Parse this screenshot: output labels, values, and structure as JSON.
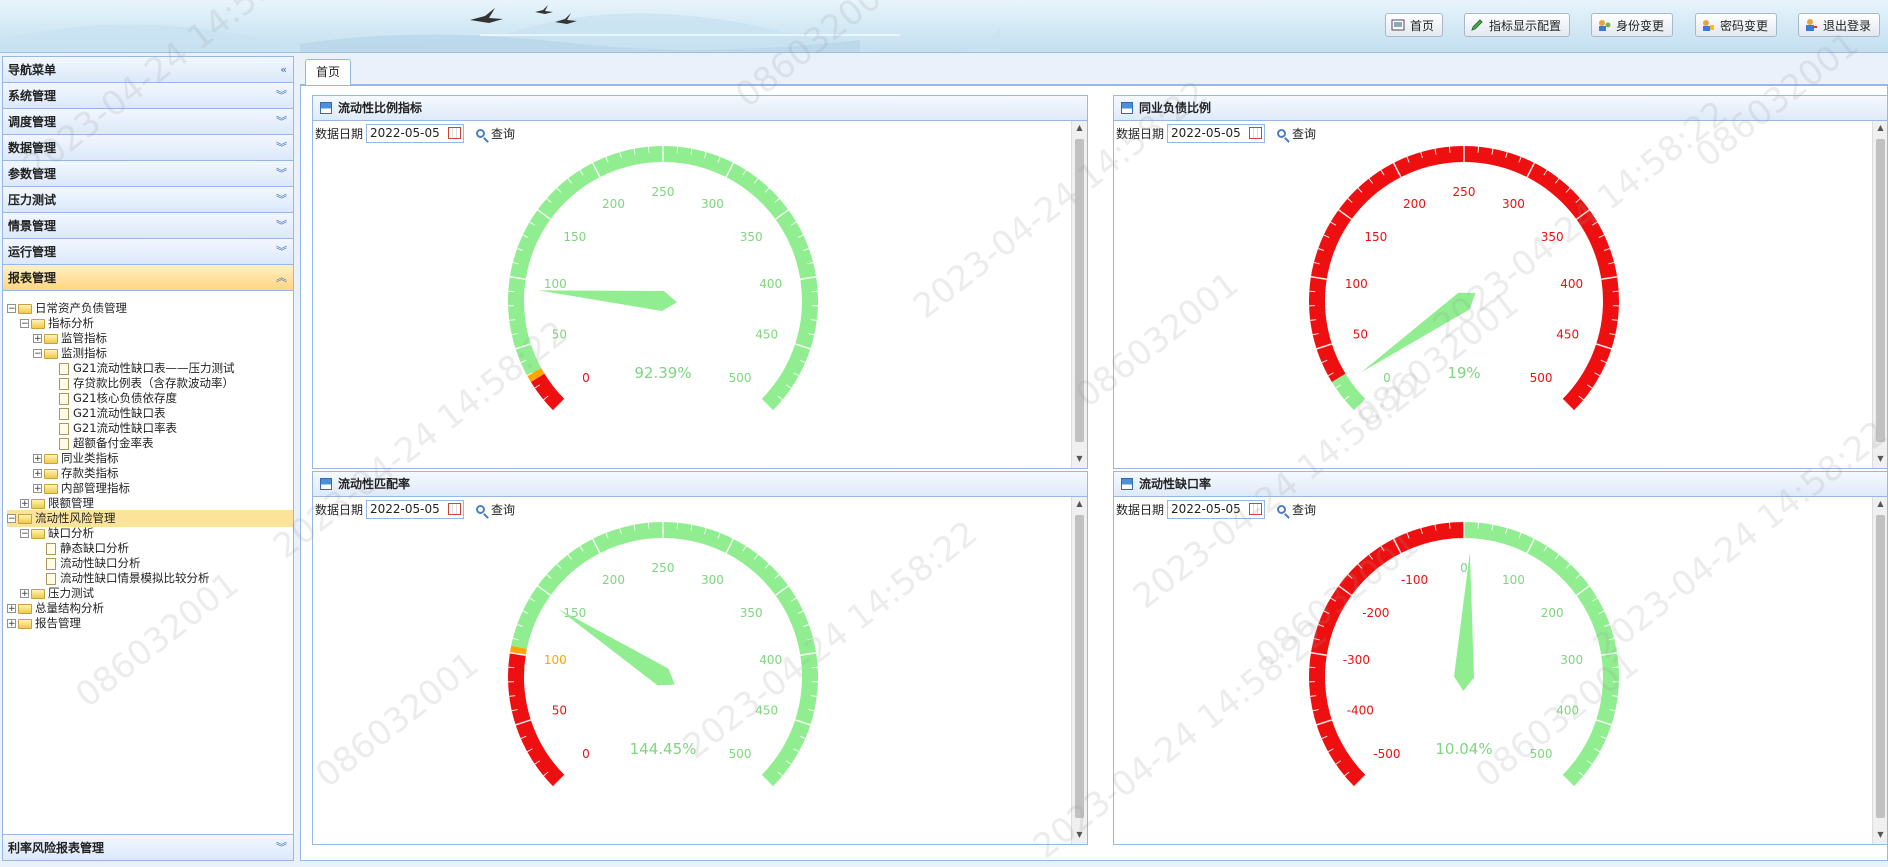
{
  "topbar": {
    "buttons": [
      {
        "label": "首页",
        "icon": "home-icon"
      },
      {
        "label": "指标显示配置",
        "icon": "pencil-icon"
      },
      {
        "label": "身份变更",
        "icon": "user-switch-icon"
      },
      {
        "label": "密码变更",
        "icon": "key-icon"
      },
      {
        "label": "退出登录",
        "icon": "logout-icon"
      }
    ]
  },
  "sidebar": {
    "title": "导航菜单",
    "sections": [
      "系统管理",
      "调度管理",
      "数据管理",
      "参数管理",
      "压力测试",
      "情景管理",
      "运行管理",
      "报表管理"
    ],
    "bottom_section": "利率风险报表管理",
    "tree": [
      {
        "label": "日常资产负债管理",
        "type": "folder",
        "expander": "−"
      },
      {
        "label": "指标分析",
        "type": "folder",
        "expander": "−"
      },
      {
        "label": "监管指标",
        "type": "folder",
        "expander": "+"
      },
      {
        "label": "监测指标",
        "type": "folder",
        "expander": "−"
      },
      {
        "label": "G21流动性缺口表——压力测试",
        "type": "page"
      },
      {
        "label": "存贷款比例表（含存款波动率）",
        "type": "page"
      },
      {
        "label": "G21核心负债依存度",
        "type": "page"
      },
      {
        "label": "G21流动性缺口表",
        "type": "page"
      },
      {
        "label": "G21流动性缺口率表",
        "type": "page"
      },
      {
        "label": "超额备付金率表",
        "type": "page"
      },
      {
        "label": "同业类指标",
        "type": "folder",
        "expander": "+"
      },
      {
        "label": "存款类指标",
        "type": "folder",
        "expander": "+"
      },
      {
        "label": "内部管理指标",
        "type": "folder",
        "expander": "+"
      },
      {
        "label": "限额管理",
        "type": "folder",
        "expander": "+"
      },
      {
        "label": "流动性风险管理",
        "type": "folder",
        "expander": "−"
      },
      {
        "label": "缺口分析",
        "type": "folder",
        "expander": "−"
      },
      {
        "label": "静态缺口分析",
        "type": "page"
      },
      {
        "label": "流动性缺口分析",
        "type": "page"
      },
      {
        "label": "流动性缺口情景模拟比较分析",
        "type": "page"
      },
      {
        "label": "压力测试",
        "type": "folder",
        "expander": "+"
      },
      {
        "label": "总量结构分析",
        "type": "folder",
        "expander": "+"
      },
      {
        "label": "报告管理",
        "type": "folder",
        "expander": "+"
      }
    ]
  },
  "tabs": {
    "home": "首页"
  },
  "filter": {
    "date_label": "数据日期",
    "query_label": "查询"
  },
  "colors": {
    "green": "#90ee90",
    "red": "#ee1010",
    "orange": "#ffa500"
  },
  "watermark": {
    "date": "2023-04-24 14:58:22",
    "id": "086032001"
  },
  "panels": [
    {
      "title": "流动性比例指标",
      "date": "2022-05-05"
    },
    {
      "title": "同业负债比例",
      "date": "2022-05-05"
    },
    {
      "title": "流动性匹配率",
      "date": "2022-05-05"
    },
    {
      "title": "流动性缺口率",
      "date": "2022-05-05"
    }
  ],
  "chart_data": [
    {
      "type": "gauge",
      "title": "流动性比例指标",
      "min": 0,
      "max": 500,
      "value": 92.39,
      "value_label": "92.39%",
      "tick_labels": [
        "0",
        "50",
        "100",
        "150",
        "200",
        "250",
        "300",
        "350",
        "400",
        "450",
        "500"
      ],
      "bands": [
        {
          "from": 0,
          "to": 25,
          "color": "red"
        },
        {
          "from": 25,
          "to": 30,
          "color": "orange"
        },
        {
          "from": 30,
          "to": 500,
          "color": "green"
        }
      ]
    },
    {
      "type": "gauge",
      "title": "同业负债比例",
      "min": 0,
      "max": 500,
      "value": 19,
      "value_label": "19%",
      "tick_labels": [
        "0",
        "50",
        "100",
        "150",
        "200",
        "250",
        "300",
        "350",
        "400",
        "450",
        "500"
      ],
      "bands": [
        {
          "from": 0,
          "to": 25,
          "color": "green"
        },
        {
          "from": 25,
          "to": 500,
          "color": "red"
        }
      ]
    },
    {
      "type": "gauge",
      "title": "流动性匹配率",
      "min": 0,
      "max": 500,
      "value": 144.45,
      "value_label": "144.45%",
      "tick_labels": [
        "0",
        "50",
        "100",
        "150",
        "200",
        "250",
        "300",
        "350",
        "400",
        "450",
        "500"
      ],
      "bands": [
        {
          "from": 0,
          "to": 100,
          "color": "red"
        },
        {
          "from": 100,
          "to": 105,
          "color": "orange"
        },
        {
          "from": 105,
          "to": 500,
          "color": "green"
        }
      ]
    },
    {
      "type": "gauge",
      "title": "流动性缺口率",
      "min": -500,
      "max": 500,
      "value": 10.04,
      "value_label": "10.04%",
      "tick_labels": [
        "-500",
        "-400",
        "-300",
        "-200",
        "-100",
        "0",
        "100",
        "200",
        "300",
        "400",
        "500"
      ],
      "bands": [
        {
          "from": -500,
          "to": 0,
          "color": "red"
        },
        {
          "from": 0,
          "to": 500,
          "color": "green"
        }
      ]
    }
  ]
}
